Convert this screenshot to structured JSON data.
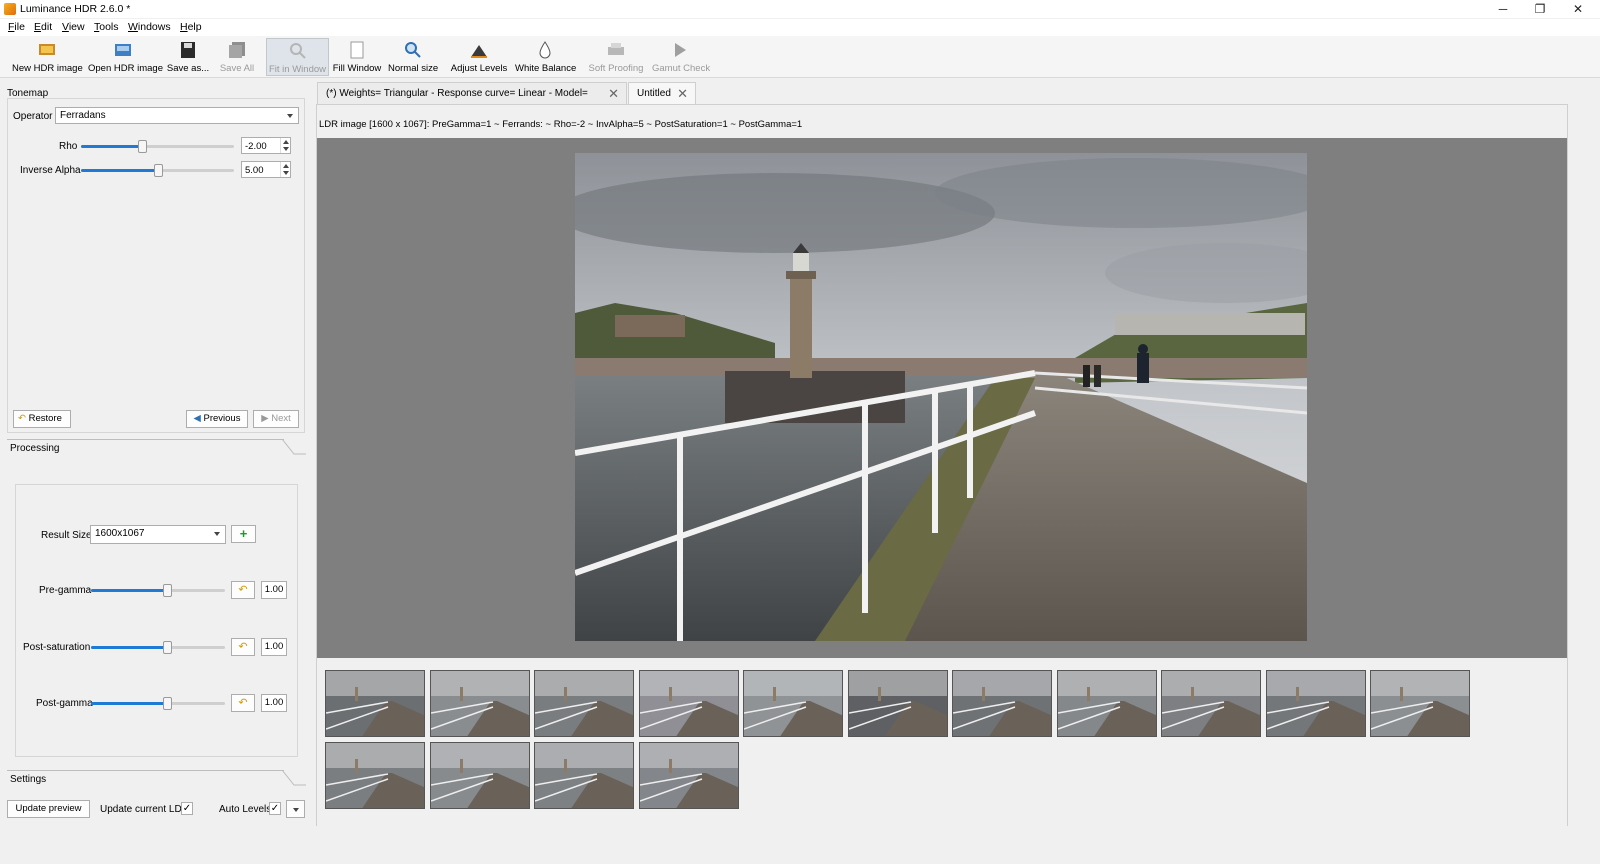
{
  "window": {
    "title": "Luminance HDR 2.6.0 *",
    "controls": {
      "minimize": "─",
      "maximize": "❐",
      "close": "✕"
    }
  },
  "menu": [
    "File",
    "Edit",
    "View",
    "Tools",
    "Windows",
    "Help"
  ],
  "toolbar": [
    {
      "label": "New HDR image",
      "icon": "new-hdr-icon",
      "enabled": true
    },
    {
      "label": "Open HDR image",
      "icon": "open-hdr-icon",
      "enabled": true
    },
    {
      "label": "Save as...",
      "icon": "save-icon",
      "enabled": true
    },
    {
      "label": "Save All",
      "icon": "save-all-icon",
      "enabled": false
    },
    {
      "label": "Fit in Window",
      "icon": "fit-window-icon",
      "enabled": false,
      "active": true
    },
    {
      "label": "Fill Window",
      "icon": "fill-window-icon",
      "enabled": true
    },
    {
      "label": "Normal size",
      "icon": "zoom-icon",
      "enabled": true
    },
    {
      "label": "Adjust Levels",
      "icon": "levels-icon",
      "enabled": true
    },
    {
      "label": "White Balance",
      "icon": "white-balance-icon",
      "enabled": true
    },
    {
      "label": "Soft Proofing",
      "icon": "soft-proofing-icon",
      "enabled": false
    },
    {
      "label": "Gamut Check",
      "icon": "gamut-check-icon",
      "enabled": false
    }
  ],
  "tonemap": {
    "title": "Tonemap",
    "operator_label": "Operator",
    "operator_value": "Ferradans",
    "params": [
      {
        "label": "Rho",
        "value": "-2.00",
        "level": 0.4
      },
      {
        "label": "Inverse Alpha",
        "value": "5.00",
        "level": 0.5
      }
    ],
    "restore_label": "Restore",
    "previous_label": "Previous",
    "next_label": "Next"
  },
  "processing": {
    "title": "Processing",
    "result_size_label": "Result Size",
    "result_size_value": "1600x1067",
    "add_icon": "+",
    "reset_icon": "↶",
    "params": [
      {
        "label": "Pre-gamma",
        "value": "1.00",
        "level": 0.57
      },
      {
        "label": "Post-saturation",
        "value": "1.00",
        "level": 0.57
      },
      {
        "label": "Post-gamma",
        "value": "1.00",
        "level": 0.57
      }
    ]
  },
  "settings": {
    "title": "Settings",
    "update_preview_label": "Update preview",
    "update_ldr_label": "Update current LDR",
    "update_ldr_checked": true,
    "auto_levels_label": "Auto Levels",
    "auto_levels_checked": true,
    "check_mark": "✓"
  },
  "tabs": [
    {
      "label": "(*) Weights= Triangular - Response curve= Linear - Model= Debevec",
      "active": false
    },
    {
      "label": "Untitled",
      "active": true
    }
  ],
  "tab_close_icon": "✕",
  "image_info": "LDR image [1600 x 1067]: PreGamma=1 ~ Ferrands: ~ Rho=-2 ~ InvAlpha=5 ~ PostSaturation=1 ~ PostGamma=1",
  "thumbnails_count": 15
}
